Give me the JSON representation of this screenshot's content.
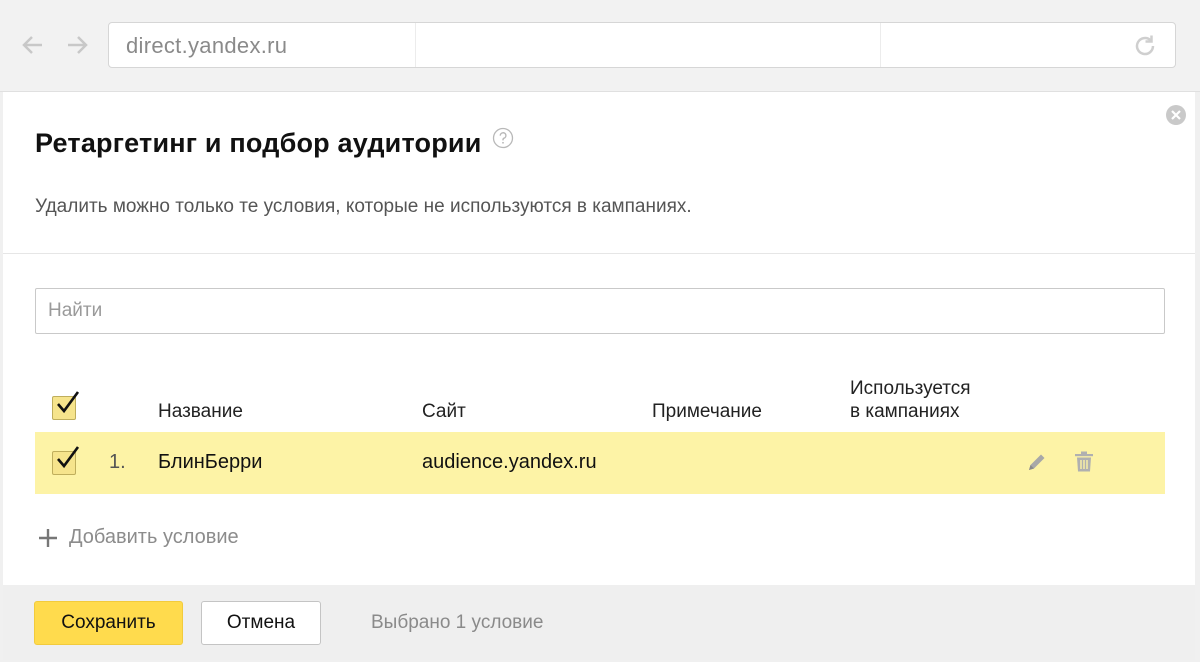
{
  "browser": {
    "url": "direct.yandex.ru",
    "back_icon": "arrow-left-icon",
    "forward_icon": "arrow-right-icon",
    "reload_icon": "reload-icon"
  },
  "dialog": {
    "title": "Ретаргетинг и подбор аудитории",
    "subtitle": "Удалить можно только те условия, которые не используются в кампаниях.",
    "search_placeholder": "Найти",
    "search_value": ""
  },
  "table": {
    "headers": {
      "name": "Название",
      "site": "Сайт",
      "note": "Примечание",
      "used_line1": "Используется",
      "used_line2": "в кампаниях"
    },
    "header_checked": true,
    "rows": [
      {
        "checked": true,
        "num": "1.",
        "name": "БлинБерри",
        "site": "audience.yandex.ru",
        "note": "",
        "used": ""
      }
    ]
  },
  "add_condition_label": "Добавить условие",
  "footer": {
    "save_label": "Сохранить",
    "cancel_label": "Отмена",
    "selected_text": "Выбрано 1 условие"
  },
  "colors": {
    "accent_yellow": "#ffdb4d",
    "row_highlight": "#fdf3a6",
    "checkbox_fill": "#f6e48c"
  }
}
